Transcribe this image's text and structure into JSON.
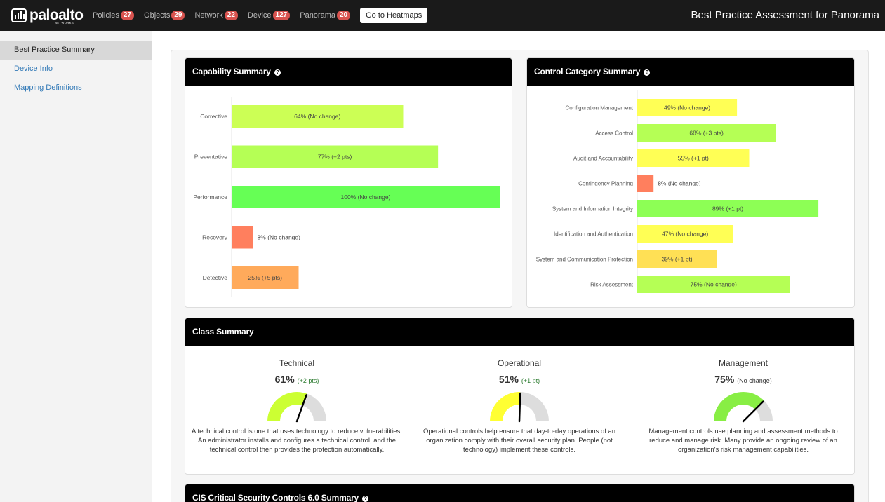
{
  "header": {
    "brand": "paloalto",
    "brand_sub": "NETWORKS",
    "nav": [
      {
        "label": "Policies",
        "badge": "27"
      },
      {
        "label": "Objects",
        "badge": "29"
      },
      {
        "label": "Network",
        "badge": "22"
      },
      {
        "label": "Device",
        "badge": "127"
      },
      {
        "label": "Panorama",
        "badge": "20"
      }
    ],
    "heatmap_button": "Go to Heatmaps",
    "page_title": "Best Practice Assessment for Panorama"
  },
  "sidebar": {
    "items": [
      {
        "label": "Best Practice Summary",
        "active": true
      },
      {
        "label": "Device Info",
        "active": false
      },
      {
        "label": "Mapping Definitions",
        "active": false
      }
    ]
  },
  "capability": {
    "title": "Capability Summary",
    "rows": [
      {
        "label": "Corrective",
        "value": 64,
        "text": "64% (No change)",
        "color": "#ccff55"
      },
      {
        "label": "Preventative",
        "value": 77,
        "text": "77% (+2 pts)",
        "color": "#b5ff55"
      },
      {
        "label": "Performance",
        "value": 100,
        "text": "100% (No change)",
        "color": "#66ff55"
      },
      {
        "label": "Recovery",
        "value": 8,
        "text": "8% (No change)",
        "color": "#ff7f5e"
      },
      {
        "label": "Detective",
        "value": 25,
        "text": "25% (+5 pts)",
        "color": "#ffaa5b"
      }
    ]
  },
  "control": {
    "title": "Control Category Summary",
    "rows": [
      {
        "label": "Configuration Management",
        "value": 49,
        "text": "49% (No change)",
        "color": "#ffff55"
      },
      {
        "label": "Access Control",
        "value": 68,
        "text": "68% (+3 pts)",
        "color": "#b5ff55"
      },
      {
        "label": "Audit and Accountability",
        "value": 55,
        "text": "55% (+1 pt)",
        "color": "#ffff55"
      },
      {
        "label": "Contingency Planning",
        "value": 8,
        "text": "8% (No change)",
        "color": "#ff7f5e"
      },
      {
        "label": "System and Information Integrity",
        "value": 89,
        "text": "89% (+1 pt)",
        "color": "#8dff55"
      },
      {
        "label": "Identification and Authentication",
        "value": 47,
        "text": "47% (No change)",
        "color": "#ffff55"
      },
      {
        "label": "System and Communication Protection",
        "value": 39,
        "text": "39% (+1 pt)",
        "color": "#ffe055"
      },
      {
        "label": "Risk Assessment",
        "value": 75,
        "text": "75% (No change)",
        "color": "#b5ff55"
      }
    ]
  },
  "class_summary": {
    "title": "Class Summary",
    "items": [
      {
        "name": "Technical",
        "value": "61%",
        "value_num": 61,
        "delta": "(+2 pts)",
        "color": "#ccff33",
        "desc": "A technical control is one that uses technology to reduce vulnerabilities. An administrator installs and configures a technical control, and the technical control then provides the protection automatically."
      },
      {
        "name": "Operational",
        "value": "51%",
        "value_num": 51,
        "delta": "(+1 pt)",
        "color": "#ffff33",
        "desc": "Operational controls help ensure that day-to-day operations of an organization comply with their overall security plan. People (not technology) implement these controls."
      },
      {
        "name": "Management",
        "value": "75%",
        "value_num": 75,
        "delta": "(No change)",
        "color": "#88ee44",
        "desc": "Management controls use planning and assessment methods to reduce and manage risk. Many provide an ongoing review of an organization's risk management capabilities."
      }
    ]
  },
  "cis": {
    "title": "CIS Critical Security Controls 6.0 Summary"
  }
}
